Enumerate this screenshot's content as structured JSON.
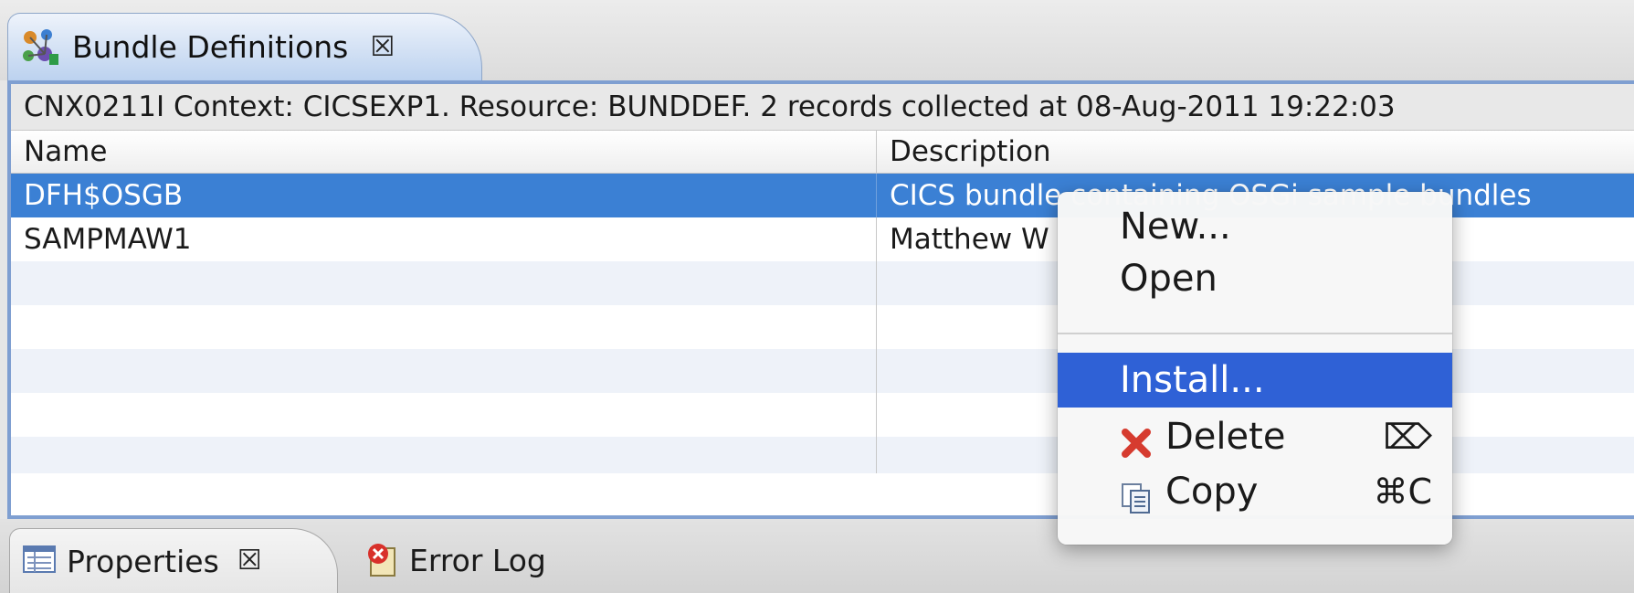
{
  "view_tab": {
    "title": "Bundle Definitions",
    "icon": "bundle-definitions-icon",
    "close_glyph": "☒"
  },
  "status_line": "CNX0211I Context: CICSEXP1. Resource: BUNDDEF. 2 records collected at 08-Aug-2011 19:22:03",
  "table": {
    "columns": [
      "Name",
      "Description"
    ],
    "rows": [
      {
        "name": "DFH$OSGB",
        "description": "CICS bundle containing OSGi sample bundles",
        "selected": true
      },
      {
        "name": "SAMPMAW1",
        "description": "Matthew W",
        "selected": false
      }
    ]
  },
  "context_menu": {
    "items": [
      {
        "label": "New...",
        "icon": null,
        "shortcut": ""
      },
      {
        "label": "Open",
        "icon": null,
        "shortcut": ""
      },
      {
        "label": "Install...",
        "icon": null,
        "shortcut": "",
        "highlighted": true
      },
      {
        "label": "Delete",
        "icon": "delete-x-icon",
        "shortcut": "⌦"
      },
      {
        "label": "Copy",
        "icon": "copy-icon",
        "shortcut": "⌘C"
      }
    ]
  },
  "bottom_tabs": [
    {
      "label": "Properties",
      "icon": "properties-icon",
      "close_glyph": "☒",
      "active": true
    },
    {
      "label": "Error Log",
      "icon": "error-log-icon",
      "active": false
    }
  ],
  "colors": {
    "selection": "#3b80d4",
    "menu_highlight": "#2f61d6",
    "panel_border": "#7f9fd1",
    "delete_red": "#d63b2f"
  }
}
